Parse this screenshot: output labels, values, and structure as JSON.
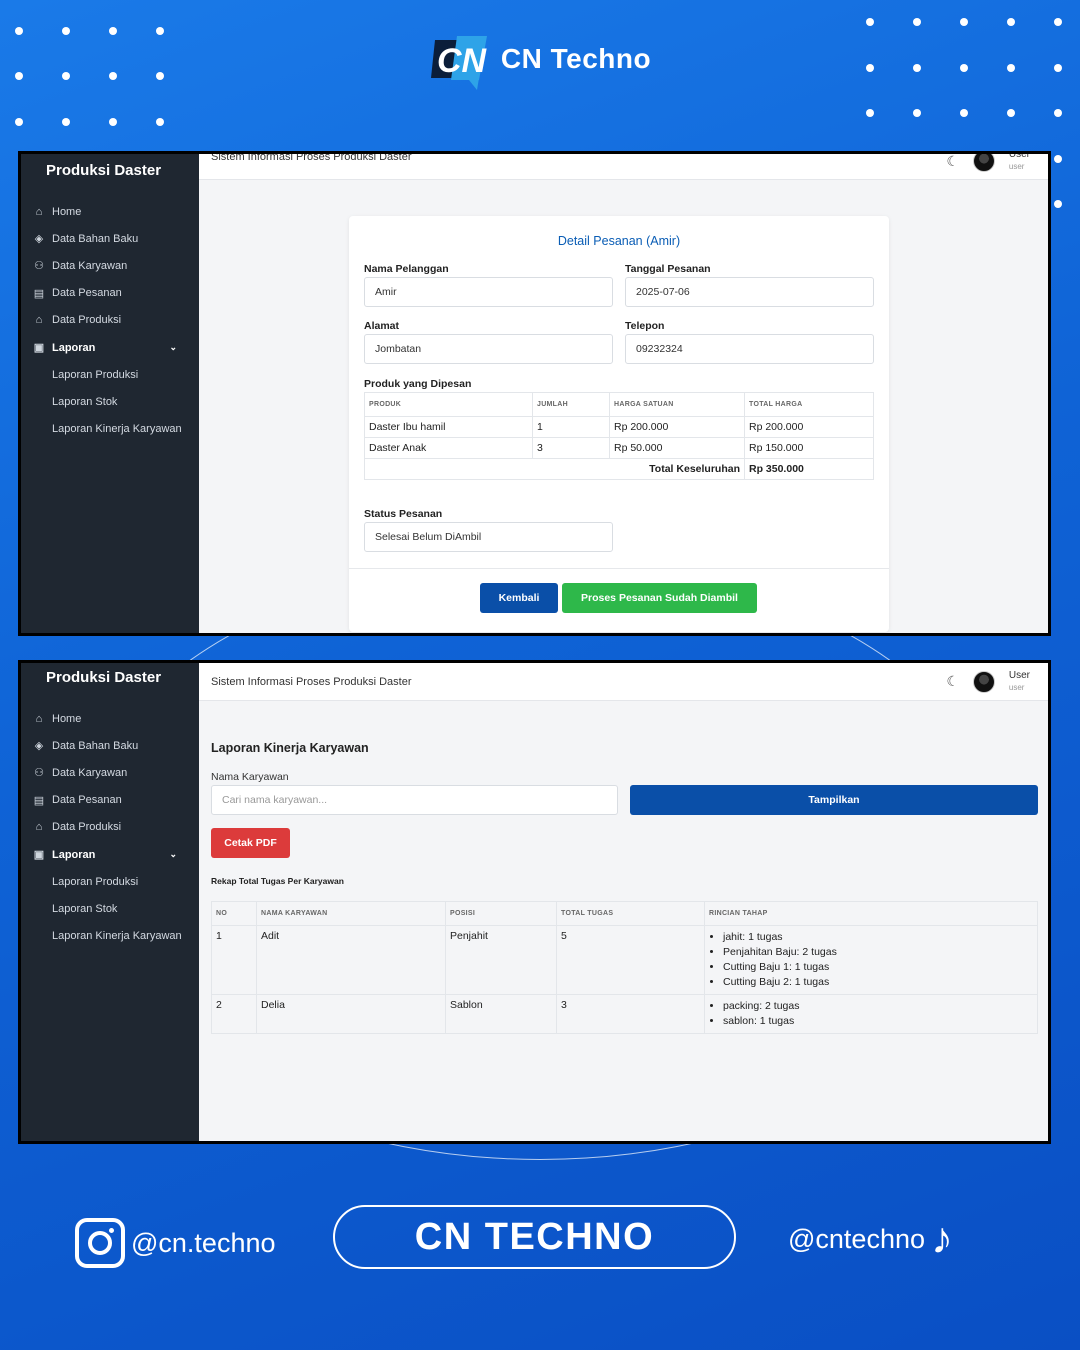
{
  "brand": {
    "name": "CN Techno",
    "logo_text": "CN"
  },
  "footer": {
    "instagram": "@cn.techno",
    "center_button": "CN TECHNO",
    "tiktok": "@cntechno"
  },
  "colors": {
    "bg": "#1469e0",
    "sidebar": "#1f2731",
    "primary": "#0a4fa8",
    "success": "#2eb84a",
    "danger": "#dc3b3b"
  },
  "sidebar": {
    "title": "Produksi Daster",
    "items": [
      {
        "label": "Home",
        "icon": "home-icon"
      },
      {
        "label": "Data Bahan Baku",
        "icon": "layers-icon"
      },
      {
        "label": "Data Karyawan",
        "icon": "users-icon"
      },
      {
        "label": "Data Pesanan",
        "icon": "file-icon"
      },
      {
        "label": "Data Produksi",
        "icon": "factory-icon"
      },
      {
        "label": "Laporan",
        "icon": "clipboard-icon"
      },
      {
        "label": "Laporan Produksi"
      },
      {
        "label": "Laporan Stok"
      },
      {
        "label": "Laporan Kinerja Karyawan"
      }
    ]
  },
  "topbar": {
    "app_title": "Sistem Informasi Proses Produksi Daster",
    "user_name": "User",
    "user_role": "user"
  },
  "order": {
    "title": "Detail Pesanan (Amir)",
    "customer_label": "Nama Pelanggan",
    "customer_value": "Amir",
    "date_label": "Tanggal Pesanan",
    "date_value": "2025-07-06",
    "address_label": "Alamat",
    "address_value": "Jombatan",
    "phone_label": "Telepon",
    "phone_value": "09232324",
    "products_label": "Produk yang Dipesan",
    "columns": [
      "PRODUK",
      "JUMLAH",
      "HARGA SATUAN",
      "TOTAL HARGA"
    ],
    "rows": [
      [
        "Daster Ibu hamil",
        "1",
        "Rp 200.000",
        "Rp 200.000"
      ],
      [
        "Daster Anak",
        "3",
        "Rp 50.000",
        "Rp 150.000"
      ]
    ],
    "total_label": "Total Keseluruhan",
    "total_value": "Rp 350.000",
    "status_label": "Status Pesanan",
    "status_value": "Selesai Belum DiAmbil",
    "back_button": "Kembali",
    "process_button": "Proses Pesanan Sudah Diambil"
  },
  "report": {
    "title": "Laporan Kinerja Karyawan",
    "name_label": "Nama Karyawan",
    "search_placeholder": "Cari nama karyawan...",
    "show_button": "Tampilkan",
    "pdf_button": "Cetak PDF",
    "summary_label": "Rekap Total Tugas Per Karyawan",
    "columns": [
      "NO",
      "NAMA KARYAWAN",
      "POSISI",
      "TOTAL TUGAS",
      "RINCIAN TAHAP"
    ],
    "rows": [
      {
        "no": "1",
        "name": "Adit",
        "position": "Penjahit",
        "total": "5",
        "details": [
          "jahit: 1 tugas",
          "Penjahitan Baju: 2 tugas",
          "Cutting Baju 1: 1 tugas",
          "Cutting Baju 2: 1 tugas"
        ]
      },
      {
        "no": "2",
        "name": "Delia",
        "position": "Sablon",
        "total": "3",
        "details": [
          "packing: 2 tugas",
          "sablon: 1 tugas"
        ]
      }
    ]
  }
}
